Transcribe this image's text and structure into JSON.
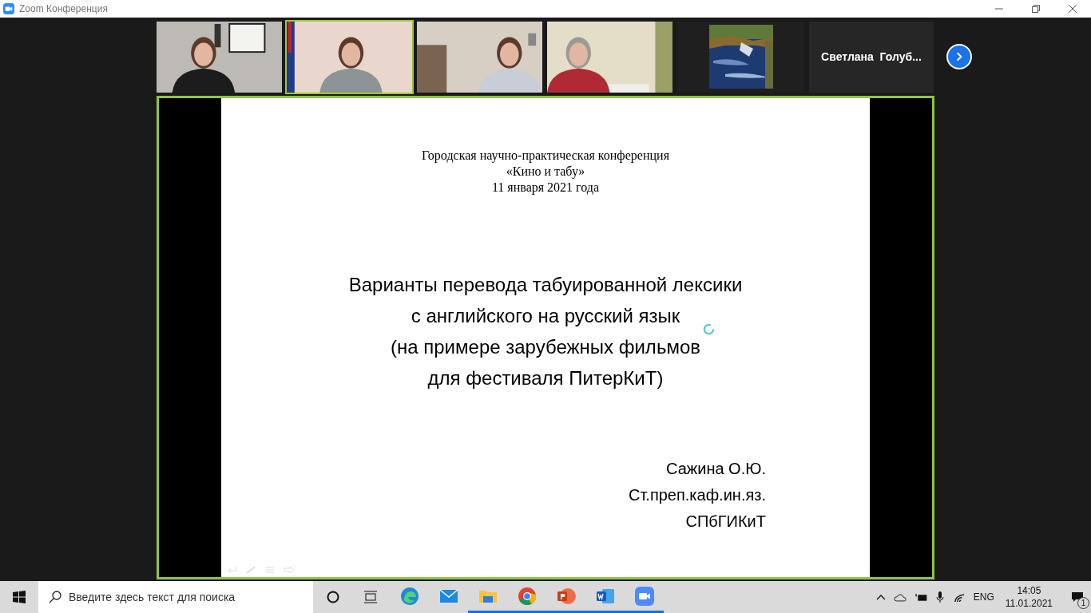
{
  "window": {
    "title": "Zoom Конференция"
  },
  "participants": [
    {
      "kind": "video",
      "selected": false
    },
    {
      "kind": "video",
      "selected": true
    },
    {
      "kind": "video",
      "selected": false
    },
    {
      "kind": "video",
      "selected": false
    },
    {
      "kind": "picture",
      "selected": false
    },
    {
      "kind": "name",
      "selected": false,
      "name": "Светлана  Голуб..."
    }
  ],
  "share": {
    "header": [
      "Городская научно-практическая конференция",
      "«Кино и табу»",
      "11 января 2021 года"
    ],
    "title": [
      "Варианты перевода табуированной лексики",
      "с английского на русский язык",
      "(на примере зарубежных фильмов",
      "для фестиваля ПитерКиТ)"
    ],
    "author": [
      "Сажина О.Ю.",
      "Ст.преп.каф.ин.яз.",
      "СПбГИКиТ"
    ]
  },
  "taskbar": {
    "search_placeholder": "Введите здесь текст для поиска",
    "apps": [
      {
        "kind": "edge",
        "running": false
      },
      {
        "kind": "mail",
        "running": false
      },
      {
        "kind": "explorer",
        "running": true
      },
      {
        "kind": "chrome",
        "running": true
      },
      {
        "kind": "powerpoint",
        "running": true
      },
      {
        "kind": "word",
        "running": true
      },
      {
        "kind": "zoom",
        "running": true
      }
    ],
    "language": "ENG",
    "time": "14:05",
    "date": "11.01.2021",
    "notifications": "1"
  }
}
